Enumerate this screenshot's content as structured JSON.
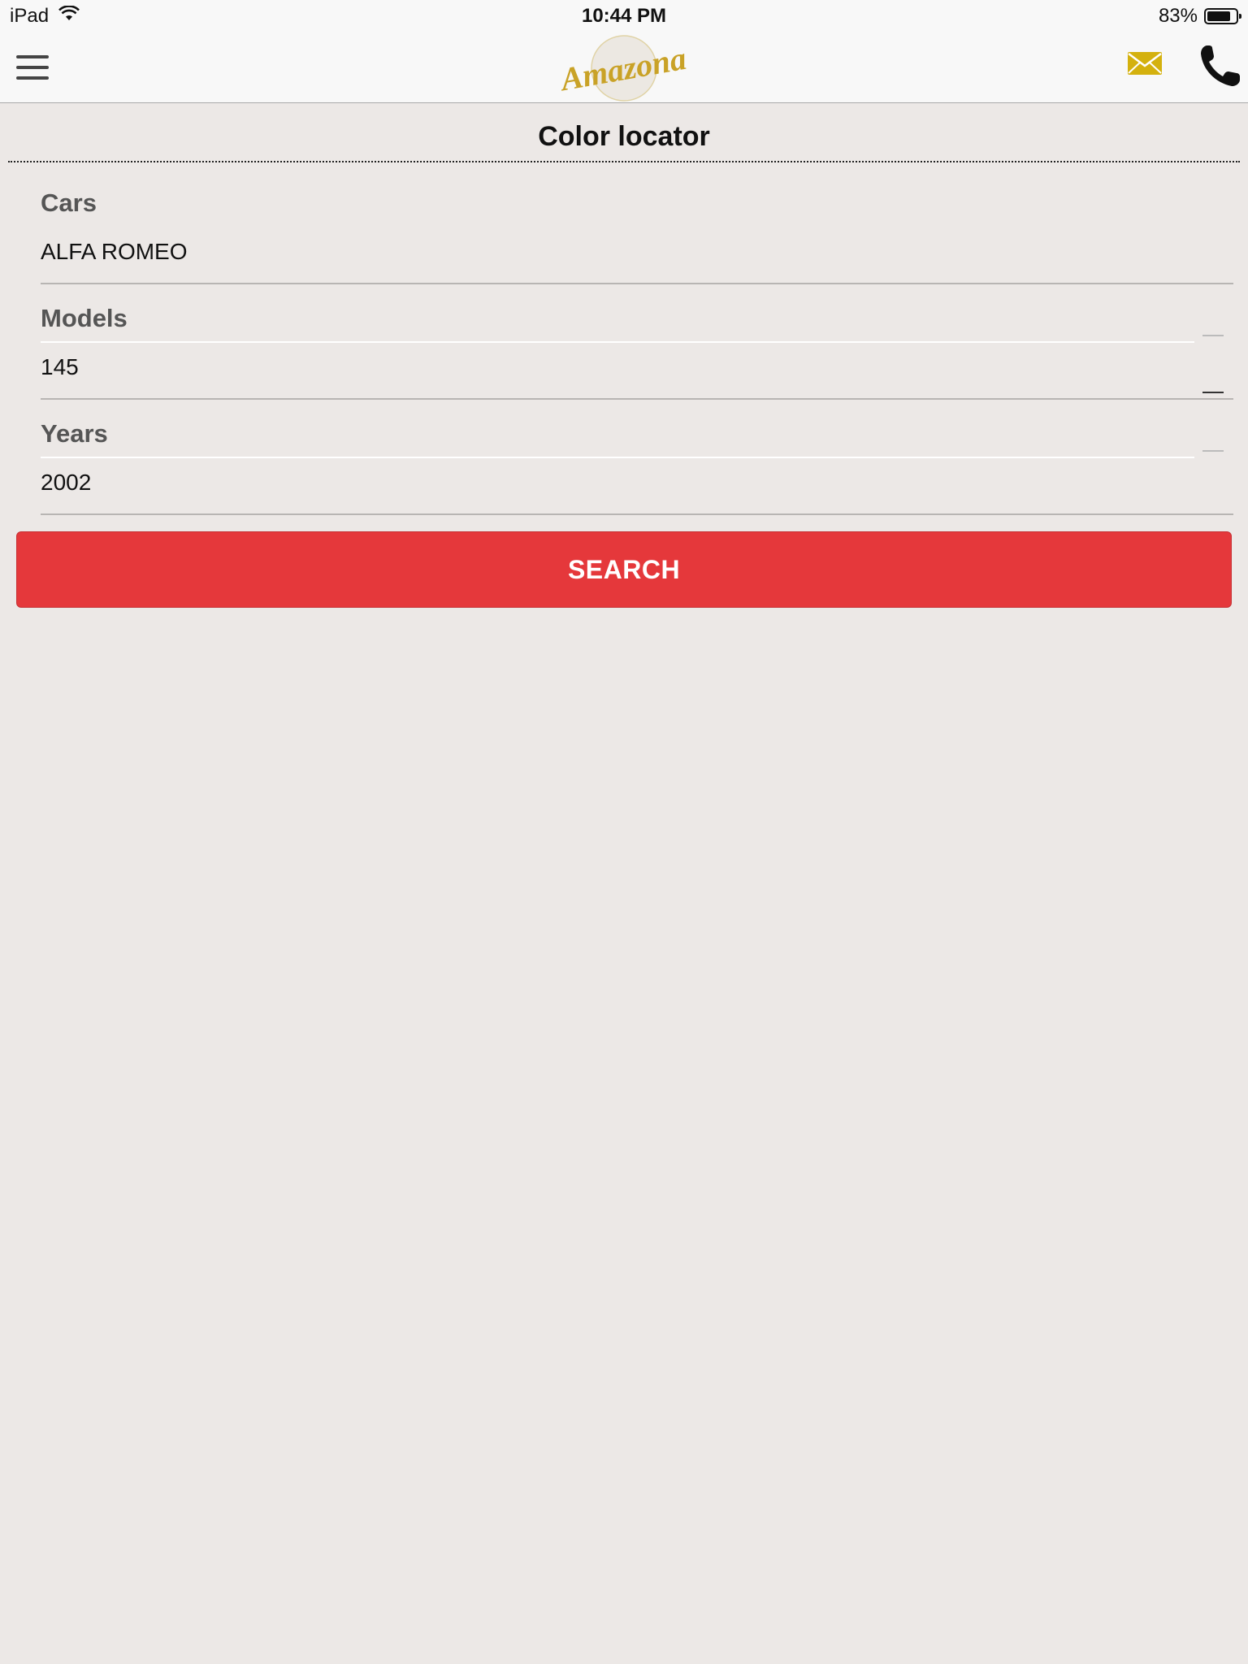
{
  "status_bar": {
    "device": "iPad",
    "time": "10:44 PM",
    "battery": "83%",
    "battery_level": 0.83,
    "wifi_icon": "wifi-icon",
    "battery_icon": "battery-icon"
  },
  "nav": {
    "menu_icon": "hamburger-menu-icon",
    "logo_text": "Amazona",
    "mail_icon": "mail-icon",
    "phone_icon": "phone-icon"
  },
  "page": {
    "title": "Color locator"
  },
  "form": {
    "cars": {
      "label": "Cars",
      "value": "ALFA ROMEO"
    },
    "models": {
      "label": "Models",
      "value": "145"
    },
    "years": {
      "label": "Years",
      "value": "2002"
    },
    "search_label": "SEARCH"
  },
  "colors": {
    "accent": "#e5383b",
    "logo_gold": "#c9a227",
    "mail_gold": "#d4b10e",
    "background": "#ece8e6"
  }
}
